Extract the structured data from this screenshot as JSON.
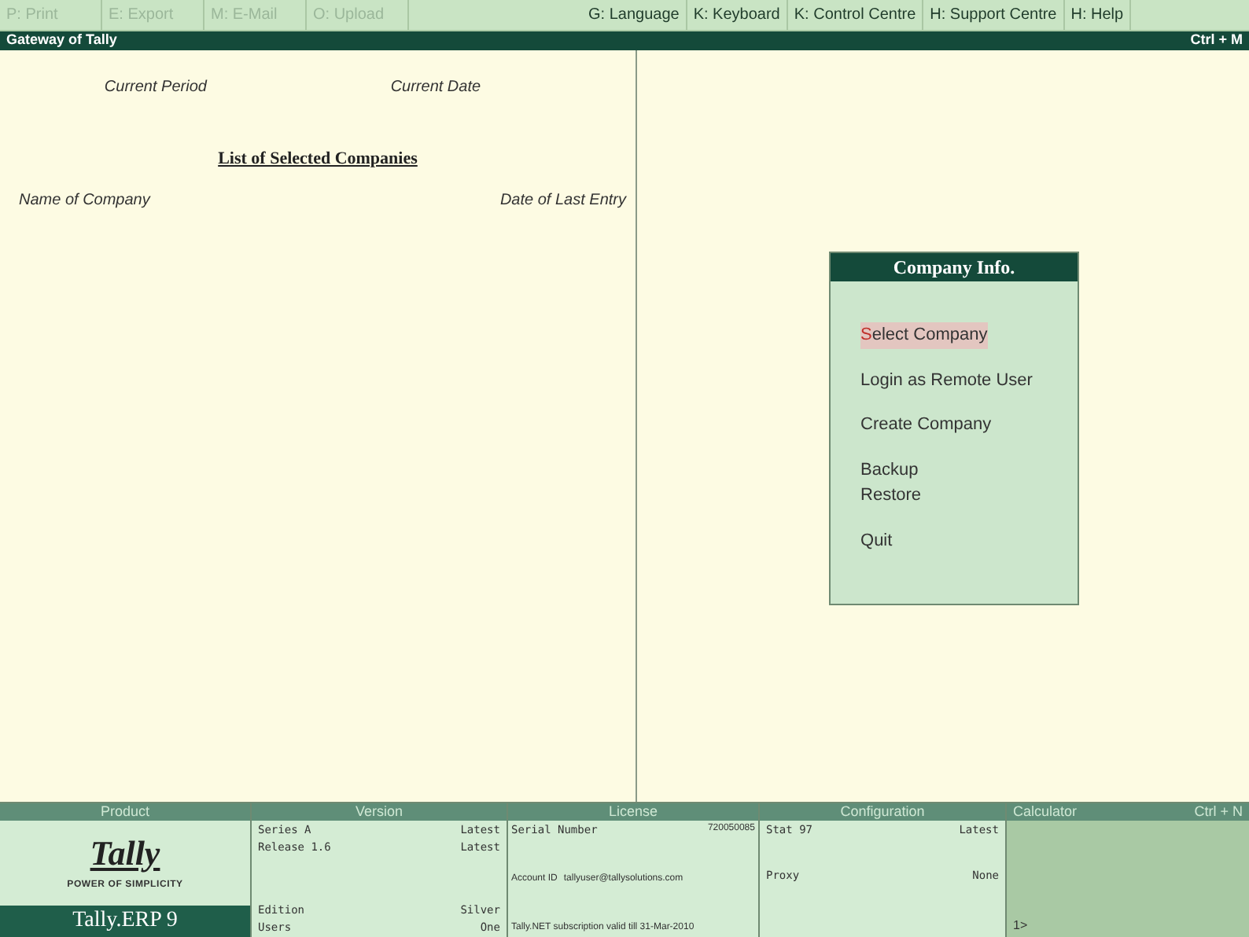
{
  "toolbar": [
    {
      "label": "P: Print",
      "disabled": true
    },
    {
      "label": "E: Export",
      "disabled": true
    },
    {
      "label": "M: E-Mail",
      "disabled": true
    },
    {
      "label": "O: Upload",
      "disabled": true
    },
    {
      "label": "G: Language",
      "disabled": false
    },
    {
      "label": "K: Keyboard",
      "disabled": false
    },
    {
      "label": "K: Control Centre",
      "disabled": false
    },
    {
      "label": "H: Support Centre",
      "disabled": false
    },
    {
      "label": "H: Help",
      "disabled": false
    }
  ],
  "title_bar": {
    "title": "Gateway of Tally",
    "shortcut": "Ctrl + M"
  },
  "left_panel": {
    "current_period": "Current Period",
    "current_date": "Current Date",
    "heading": "List of Selected Companies",
    "col_name": "Name of Company",
    "col_date": "Date of Last Entry"
  },
  "menu": {
    "title": "Company Info.",
    "groups": [
      [
        {
          "label": "Select Company",
          "selected": true
        }
      ],
      [
        {
          "label": "Login as Remote User",
          "selected": false
        }
      ],
      [
        {
          "label": "Create Company",
          "selected": false
        }
      ],
      [
        {
          "label": "Backup",
          "selected": false
        },
        {
          "label": "Restore",
          "selected": false
        }
      ],
      [
        {
          "label": "Quit",
          "selected": false
        }
      ]
    ]
  },
  "footer": {
    "product": {
      "header": "Product",
      "logo": "Tally",
      "tagline": "POWER OF SIMPLICITY",
      "name": "Tally.ERP 9"
    },
    "version": {
      "header": "Version",
      "rows": [
        [
          "Series A",
          "Latest"
        ],
        [
          "Release 1.6",
          "Latest"
        ],
        [
          "Edition",
          "Silver"
        ],
        [
          "Users",
          "One"
        ]
      ]
    },
    "license": {
      "header": "License",
      "serial_label": "Serial Number",
      "serial": "720050085",
      "account_label": "Account ID",
      "account": "tallyuser@tallysolutions.com",
      "subscription": "Tally.NET subscription valid till 31-Mar-2010"
    },
    "configuration": {
      "header": "Configuration",
      "rows": [
        [
          "Stat 97",
          "Latest"
        ],
        [
          "Proxy",
          "None"
        ]
      ]
    },
    "calculator": {
      "header": "Calculator",
      "shortcut": "Ctrl + N",
      "prompt": "1>"
    }
  }
}
